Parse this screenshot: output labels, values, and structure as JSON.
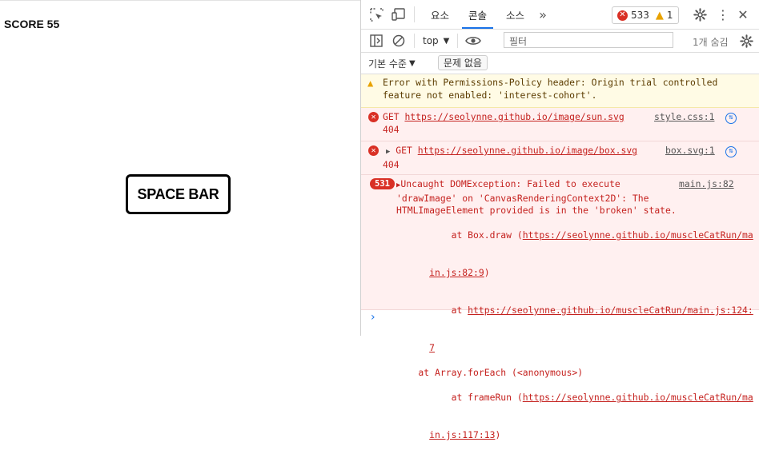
{
  "game": {
    "score_label": "SCORE 55",
    "space_button_label": "SPACE BAR"
  },
  "devtools": {
    "tabs": [
      {
        "label": "요소"
      },
      {
        "label": "콘솔",
        "active": true
      },
      {
        "label": "소스"
      }
    ],
    "more_tabs_icon": "chevron-double-right-icon",
    "error_count": "533",
    "warning_count": "1",
    "context_select": "top",
    "filter_placeholder": "필터",
    "hidden_count": "1개 숨김",
    "level_select": "기본 수준",
    "issues_button": "문제 없음",
    "colors": {
      "error_text": "#c5221f",
      "error_bg": "#fff0f0",
      "warning_bg": "#fffbe5",
      "accent": "#1a73e8"
    },
    "messages": [
      {
        "type": "warning",
        "text_line1": "Error with Permissions-Policy header: Origin trial controlled",
        "text_line2": "feature not enabled: 'interest-cohort'."
      },
      {
        "type": "error",
        "method": "GET",
        "url": "https://seolynne.github.io/image/sun.svg",
        "status": "404",
        "source": "style.css:1"
      },
      {
        "type": "error",
        "method": "GET",
        "url": "https://seolynne.github.io/image/box.svg",
        "status": "404",
        "source": "box.svg:1"
      },
      {
        "type": "error",
        "repeat_count": "531",
        "source": "main.js:82",
        "line1": "Uncaught DOMException: Failed to execute",
        "line2": "'drawImage' on 'CanvasRenderingContext2D': The",
        "line3": "HTMLImageElement provided is in the 'broken' state.",
        "stack1_prefix": "    at Box.draw (",
        "stack1_link_a": "https://seolynne.github.io/muscleCatRun/ma",
        "stack1_link_b": "in.js:82:9",
        "stack1_suffix": ")",
        "stack2_prefix": "    at ",
        "stack2_link_a": "https://seolynne.github.io/muscleCatRun/main.js:124:",
        "stack2_link_b": "7",
        "stack3": "    at Array.forEach (<anonymous>)",
        "stack4_prefix": "    at frameRun (",
        "stack4_link_a": "https://seolynne.github.io/muscleCatRun/ma",
        "stack4_link_b": "in.js:117:13",
        "stack4_suffix": ")"
      }
    ],
    "prompt_symbol": "›"
  }
}
